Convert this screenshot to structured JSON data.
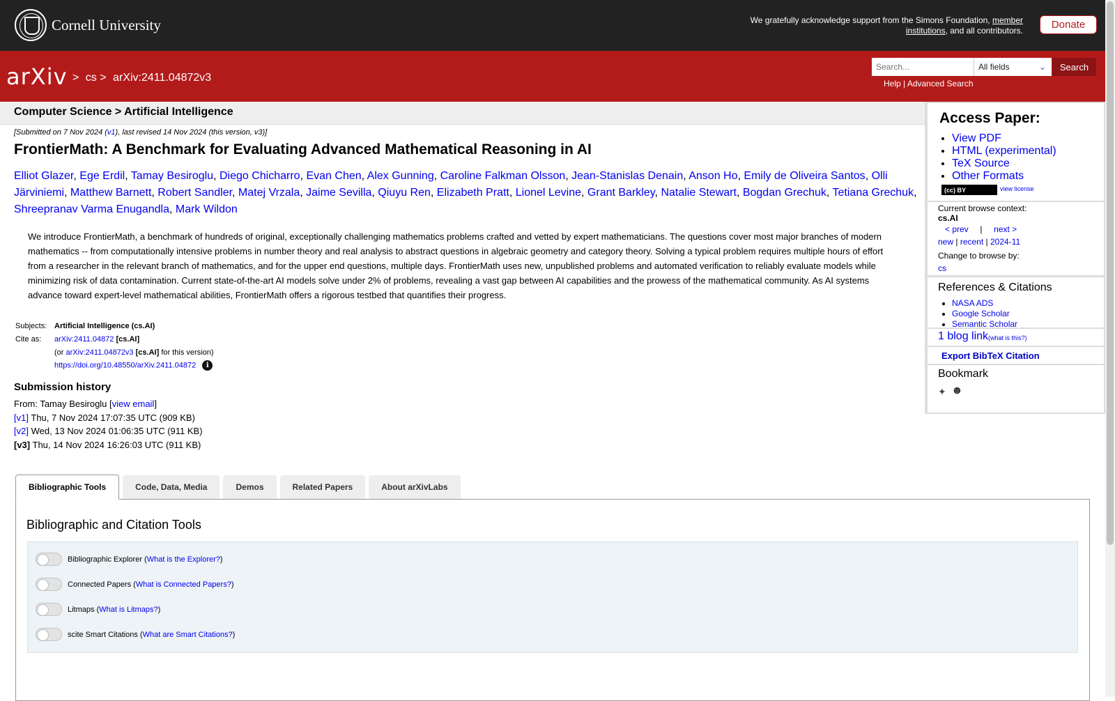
{
  "top_bar": {
    "institution": "Cornell University",
    "support_text": "We gratefully acknowledge support from the Simons Foundation,",
    "support_link": "member institutions",
    "support_tail": ", and all contributors.",
    "donate": "Donate"
  },
  "header": {
    "logo": "arXiv",
    "breadcrumb": [
      ">",
      "cs",
      ">",
      "arXiv:2411.04872v3"
    ],
    "search_placeholder": "Search...",
    "search_field": "All fields",
    "search_button": "Search",
    "help": "Help",
    "sep": "|",
    "advanced": "Advanced Search"
  },
  "category": "Computer Science > Artificial Intelligence",
  "dateline": {
    "pre": "[Submitted on 7 Nov 2024 (",
    "v1": "v1",
    "post": "), last revised 14 Nov 2024 (this version, v3)]"
  },
  "title": "FrontierMath: A Benchmark for Evaluating Advanced Mathematical Reasoning in AI",
  "authors": [
    "Elliot Glazer",
    "Ege Erdil",
    "Tamay Besiroglu",
    "Diego Chicharro",
    "Evan Chen",
    "Alex Gunning",
    "Caroline Falkman Olsson",
    "Jean-Stanislas Denain",
    "Anson Ho",
    "Emily de Oliveira Santos",
    "Olli Järviniemi",
    "Matthew Barnett",
    "Robert Sandler",
    "Matej Vrzala",
    "Jaime Sevilla",
    "Qiuyu Ren",
    "Elizabeth Pratt",
    "Lionel Levine",
    "Grant Barkley",
    "Natalie Stewart",
    "Bogdan Grechuk",
    "Tetiana Grechuk",
    "Shreepranav Varma Enugandla",
    "Mark Wildon"
  ],
  "abstract": "We introduce FrontierMath, a benchmark of hundreds of original, exceptionally challenging mathematics problems crafted and vetted by expert mathematicians. The questions cover most major branches of modern mathematics -- from computationally intensive problems in number theory and real analysis to abstract questions in algebraic geometry and category theory. Solving a typical problem requires multiple hours of effort from a researcher in the relevant branch of mathematics, and for the upper end questions, multiple days. FrontierMath uses new, unpublished problems and automated verification to reliably evaluate models while minimizing risk of data contamination. Current state-of-the-art AI models solve under 2% of problems, revealing a vast gap between AI capabilities and the prowess of the mathematical community. As AI systems advance toward expert-level mathematical abilities, FrontierMath offers a rigorous testbed that quantifies their progress.",
  "meta": {
    "subjects_label": "Subjects:",
    "subjects": "Artificial Intelligence (cs.AI)",
    "cite_label": "Cite as:",
    "cite_id": "arXiv:2411.04872",
    "cite_cat": "[cs.AI]",
    "version_pre": "(or",
    "version_id": "arXiv:2411.04872v3",
    "version_cat": "[cs.AI]",
    "version_post": "for this version)",
    "doi": "https://doi.org/10.48550/arXiv.2411.04872"
  },
  "submission": {
    "title": "Submission history",
    "from": "From: Tamay Besiroglu [",
    "email": "view email",
    "from_close": "]",
    "versions": [
      {
        "label": "[v1]",
        "text": "Thu, 7 Nov 2024 17:07:35 UTC (909 KB)"
      },
      {
        "label": "[v2]",
        "text": "Wed, 13 Nov 2024 01:06:35 UTC (911 KB)"
      },
      {
        "label": "[v3]",
        "text": "Thu, 14 Nov 2024 16:26:03 UTC (911 KB)"
      }
    ]
  },
  "tabs": [
    "Bibliographic Tools",
    "Code, Data, Media",
    "Demos",
    "Related Papers",
    "About arXivLabs"
  ],
  "panel": {
    "title": "Bibliographic and Citation Tools",
    "tools": [
      {
        "name": "Bibliographic Explorer",
        "link": "What is the Explorer?"
      },
      {
        "name": "Connected Papers",
        "link": "What is Connected Papers?"
      },
      {
        "name": "Litmaps",
        "link": "What is Litmaps?"
      },
      {
        "name": "scite Smart Citations",
        "link": "What are Smart Citations?"
      }
    ]
  },
  "sidebar": {
    "access_title": "Access Paper:",
    "access_links": [
      "View PDF",
      "HTML (experimental)",
      "TeX Source",
      "Other Formats"
    ],
    "license_badge": "(cc) BY",
    "view_license": "view license",
    "context_label": "Current browse context:",
    "context": "cs.AI",
    "prev": "< prev",
    "sep": "|",
    "next": "next >",
    "new": "new",
    "recent": "recent",
    "month": "2024-11",
    "change_label": "Change to browse by:",
    "change_cat": "cs",
    "refs_title": "References & Citations",
    "refs": [
      "NASA ADS",
      "Google Scholar",
      "Semantic Scholar"
    ],
    "blog": "1 blog link",
    "blog_what": "(what is this?)",
    "export": "Export BibTeX Citation",
    "bookmark": "Bookmark"
  }
}
